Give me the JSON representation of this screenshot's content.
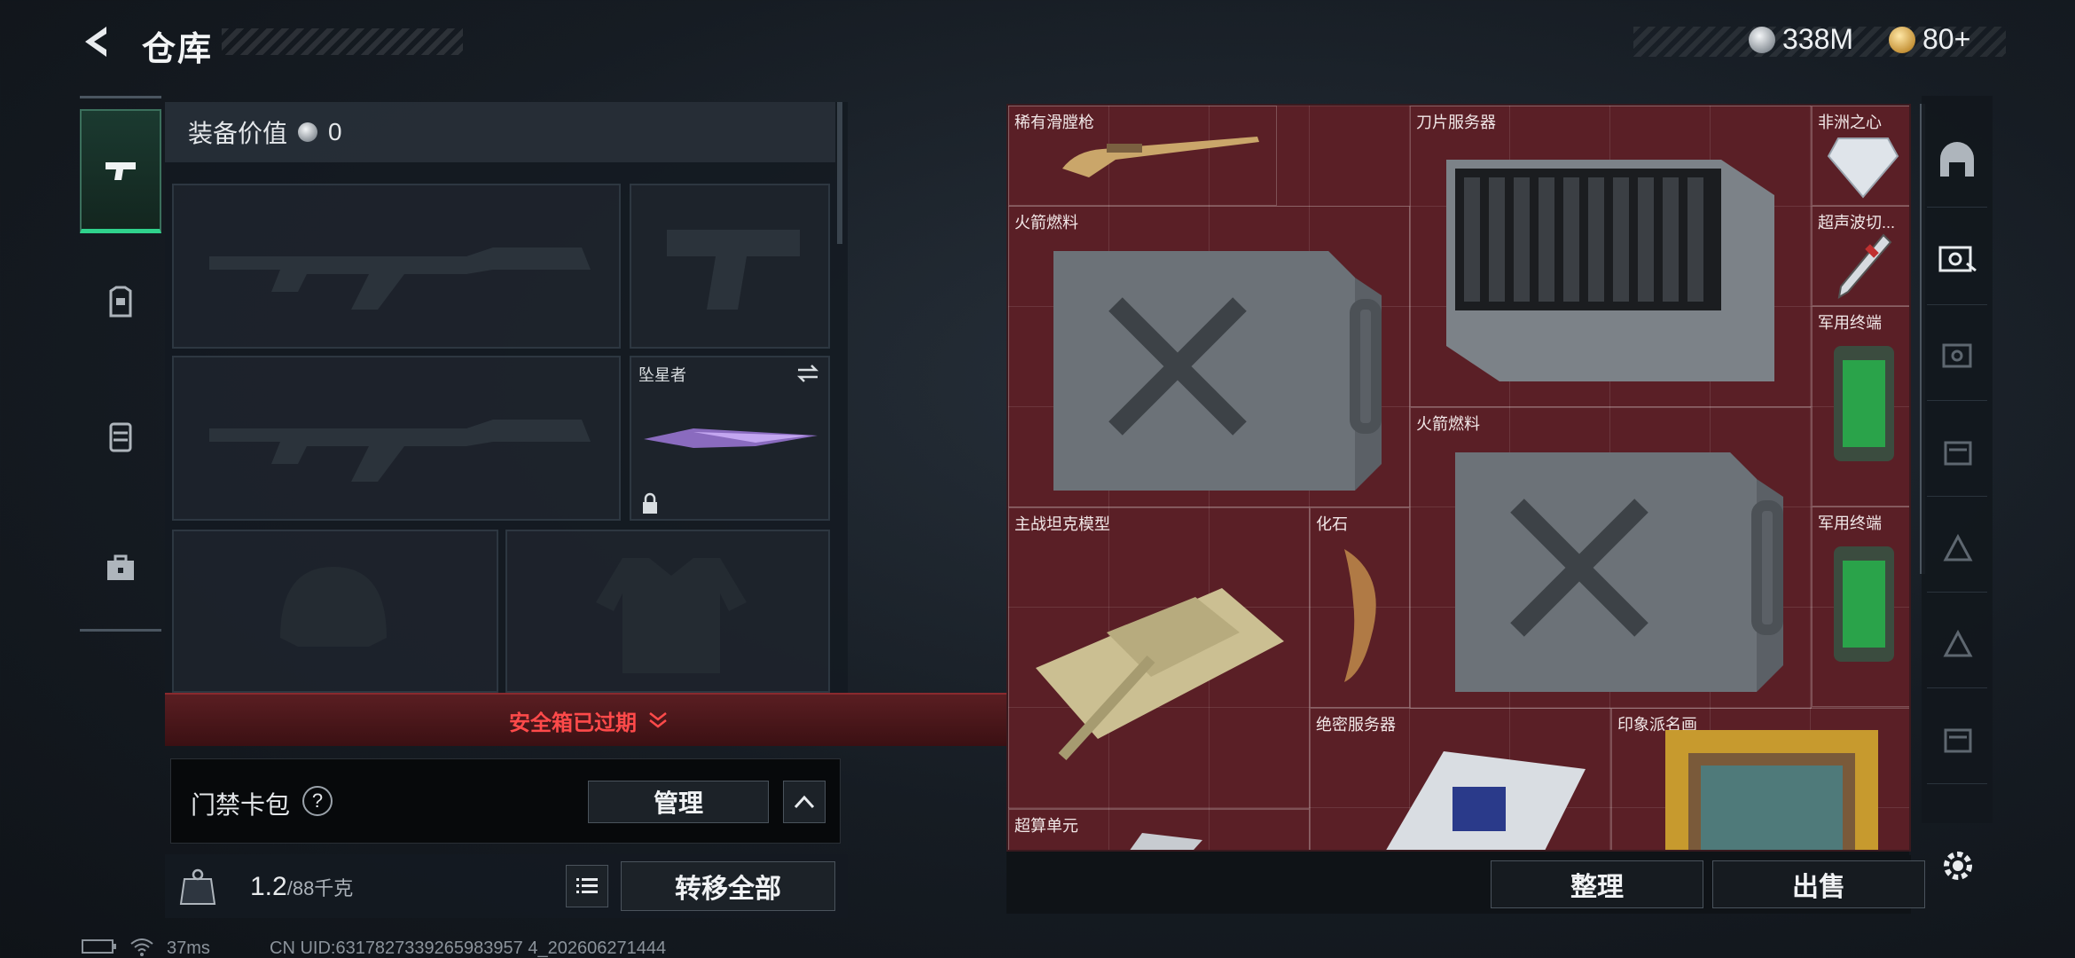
{
  "header": {
    "title": "仓库",
    "currency_silver": "338M",
    "currency_gold": "80+"
  },
  "equipment": {
    "header_label": "装备价值",
    "value": "0",
    "melee_slot_label": "坠星者"
  },
  "safebox": {
    "expired_text": "安全箱已过期"
  },
  "access_card": {
    "label": "门禁卡包",
    "help_glyph": "?",
    "manage_label": "管理"
  },
  "weight": {
    "current": "1.2",
    "max": "/88千克",
    "transfer_all_label": "转移全部"
  },
  "stash": {
    "items": [
      {
        "name": "稀有滑膛枪"
      },
      {
        "name": "刀片服务器"
      },
      {
        "name": "非洲之心"
      },
      {
        "name": "火箭燃料"
      },
      {
        "name": "超声波切..."
      },
      {
        "name": "军用终端"
      },
      {
        "name": "火箭燃料"
      },
      {
        "name": "主战坦克模型"
      },
      {
        "name": "化石"
      },
      {
        "name": "军用终端"
      },
      {
        "name": "绝密服务器"
      },
      {
        "name": "印象派名画"
      },
      {
        "name": "超算单元"
      }
    ],
    "sort_label": "整理",
    "sell_label": "出售"
  },
  "status_bar": {
    "ping": "37ms",
    "uid": "CN UID:6317827339265983957 4_202606271444"
  },
  "colors": {
    "accent_green": "#2fd28c",
    "stash_red": "#5a1f26",
    "warning_red": "#ff4a4a"
  },
  "icons": {
    "back": "back-chevron-icon",
    "pistol": "pistol-icon",
    "armor": "armor-icon",
    "backpack": "backpack-icon",
    "medkit": "toolbox-icon",
    "gear": "gear-icon"
  }
}
